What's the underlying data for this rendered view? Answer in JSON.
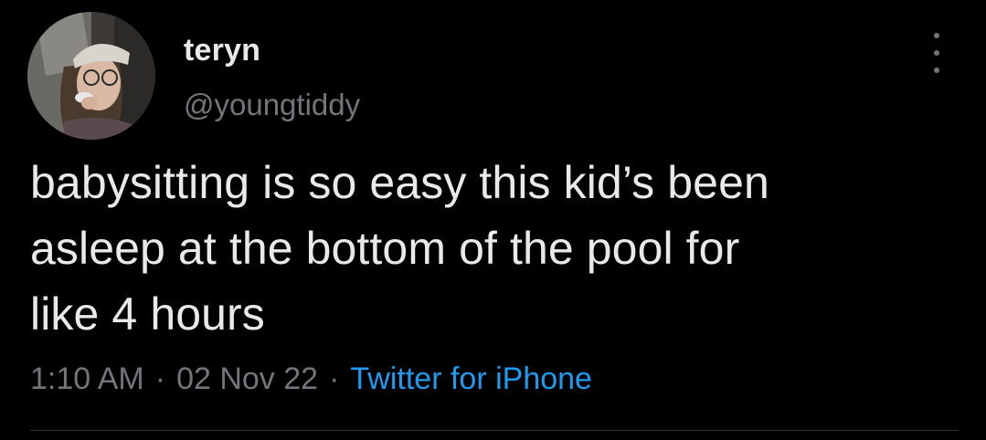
{
  "tweet": {
    "author": {
      "display_name": "teryn",
      "handle": "@youngtiddy",
      "avatar_icon": "profile-photo"
    },
    "text": "babysitting is so easy this kid’s been\nasleep at the bottom of the pool for\nlike 4 hours",
    "meta": {
      "time": "1:10 AM",
      "separator": "·",
      "date": "02 Nov 22",
      "source": "Twitter for iPhone"
    },
    "more_icon": "more-vertical-icon"
  },
  "colors": {
    "background": "#000000",
    "primary_text": "#e7e9ea",
    "secondary_text": "#71767b",
    "accent": "#1d9bf0",
    "divider": "#2f3336"
  }
}
